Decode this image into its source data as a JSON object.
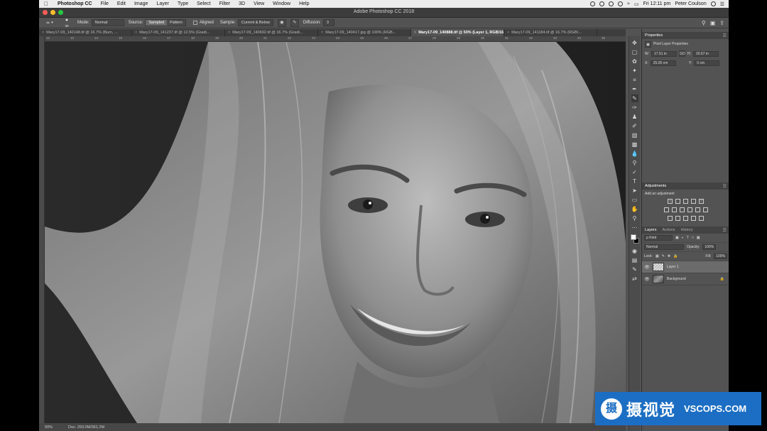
{
  "menubar": {
    "app_name": "Photoshop CC",
    "items": [
      "File",
      "Edit",
      "Image",
      "Layer",
      "Type",
      "Select",
      "Filter",
      "3D",
      "View",
      "Window",
      "Help"
    ],
    "clock": "Fri 12:11 pm",
    "user": "Peter Coulson"
  },
  "window": {
    "title": "Adobe Photoshop CC 2018"
  },
  "options": {
    "brush_size": "30",
    "mode_label": "Mode:",
    "mode_value": "Normal",
    "source_label": "Source:",
    "source_sampled": "Sampled",
    "source_pattern": "Pattern",
    "aligned_label": "Aligned",
    "sample_label": "Sample:",
    "sample_value": "Current & Below",
    "diffusion_label": "Diffusion:",
    "diffusion_value": "3"
  },
  "tabs": [
    "Mary17-09_140148.tif @ 16.7% (Burn, ...",
    "Mary17-09_141237.tif @ 12.5% (Gradi...",
    "Mary17-09_140692.tif @ 16.7% (Gradi...",
    "Mary17-09_140417.jpg @ 100% (RGB...",
    "Mary17-09_140888.tif @ 50% (Layer 1, RGB/16*) *",
    "Mary17-09_141184.tif @ 16.7% (RGB/..."
  ],
  "active_tab_index": 4,
  "ruler_ticks": [
    "12",
    "13",
    "14",
    "15",
    "16",
    "17",
    "18",
    "19",
    "20",
    "21",
    "22",
    "23",
    "24",
    "25",
    "26",
    "27",
    "28",
    "29",
    "30",
    "31",
    "32",
    "33",
    "34",
    "35"
  ],
  "status": {
    "zoom": "50%",
    "doc": "Doc: 293.0M/361.2M"
  },
  "tools": [
    "move-tool",
    "marquee-tool",
    "lasso-tool",
    "quick-select-tool",
    "crop-tool",
    "eyedropper-tool",
    "healing-brush-tool",
    "brush-tool",
    "clone-stamp-tool",
    "history-brush-tool",
    "eraser-tool",
    "gradient-tool",
    "blur-tool",
    "dodge-tool",
    "pen-tool",
    "type-tool",
    "path-select-tool",
    "shape-tool",
    "hand-tool",
    "zoom-tool",
    "more-tools"
  ],
  "properties": {
    "title": "Properties",
    "subtitle": "Pixel Layer Properties",
    "w_label": "W:",
    "w_value": "17.51 in",
    "link": "GO",
    "h_label": "H:",
    "h_value": "20.67 in",
    "x_label": "X:",
    "x_value": "25.05 cm",
    "y_label": "Y:",
    "y_value": "0 cm"
  },
  "adjustments": {
    "title": "Adjustments",
    "subtitle": "Add an adjustment"
  },
  "layers_panel": {
    "tabs": [
      "Layers",
      "Actions",
      "History"
    ],
    "kind_label": "ρ Kind",
    "blend_mode": "Normal",
    "opacity_label": "Opacity:",
    "opacity_value": "100%",
    "lock_label": "Lock:",
    "fill_label": "Fill:",
    "fill_value": "100%",
    "layers": [
      {
        "name": "Layer 1",
        "selected": true
      },
      {
        "name": "Background",
        "selected": false
      }
    ]
  },
  "watermark": {
    "cn": "摄视觉",
    "en": "VSCOPS.COM",
    "logo": "摄"
  },
  "colors": {
    "accent": "#1c6ec4",
    "panel": "#535353",
    "photo_bg": "#2b2b2b"
  }
}
